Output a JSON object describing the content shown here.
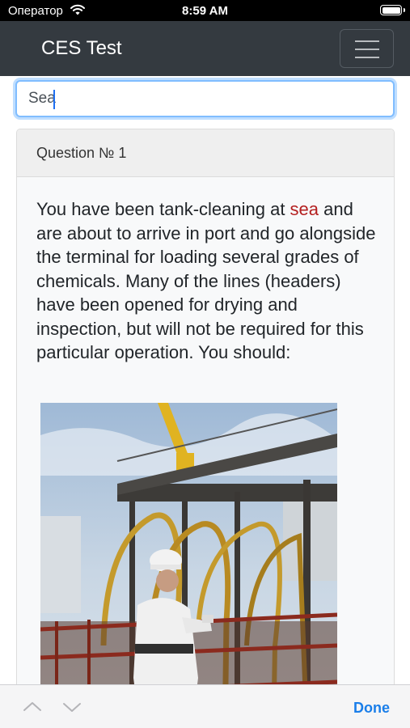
{
  "status_bar": {
    "carrier": "Оператор",
    "time": "8:59 AM"
  },
  "navbar": {
    "brand": "CES Test"
  },
  "search": {
    "value": "Sea"
  },
  "card": {
    "header": "Question № 1",
    "text_before": "You have been tank-cleaning at ",
    "highlight": "sea",
    "text_after": " and are about to arrive in port and go alongside the terminal for loading several grades of chemicals. Many of the lines (headers) have been opened for drying and inspection, but will not be required for this particular operation. You should:",
    "highlight_color": "#b41f1f"
  },
  "keyboard_toolbar": {
    "done_label": "Done"
  },
  "colors": {
    "navbar": "#343a40",
    "focus_border": "#80bdff",
    "done": "#1a7ee9"
  },
  "icons": [
    "wifi-icon",
    "battery-icon",
    "hamburger-menu-icon",
    "chevron-up-icon",
    "chevron-down-icon"
  ]
}
